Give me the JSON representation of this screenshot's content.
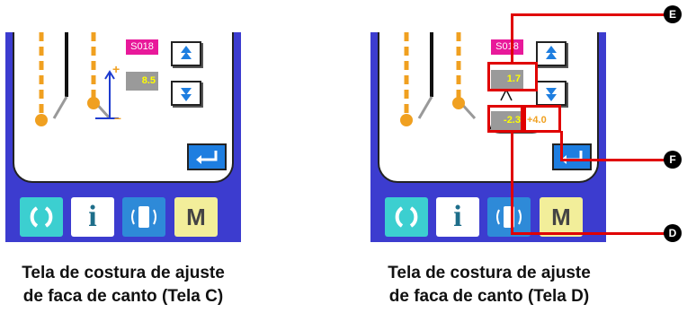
{
  "screen_c": {
    "code": "S018",
    "value": "8.5",
    "caption_line1": "Tela de costura de ajuste",
    "caption_line2": "de faca de canto (Tela C)"
  },
  "screen_d": {
    "code": "S018",
    "value_top": "1.7",
    "value_left": "-2.3",
    "value_right": "+4.0",
    "caption_line1": "Tela de costura de ajuste",
    "caption_line2": "de faca de canto (Tela D)"
  },
  "buttons": {
    "info": "i",
    "mode": "M"
  },
  "callouts": {
    "e": "E",
    "f": "F",
    "d": "D"
  },
  "colors": {
    "screen_blue": "#3c3ccf",
    "highlight_red": "#e00000",
    "code_pink": "#e8199a",
    "value_yellow": "#ffff00",
    "needle_orange": "#f0a020"
  }
}
